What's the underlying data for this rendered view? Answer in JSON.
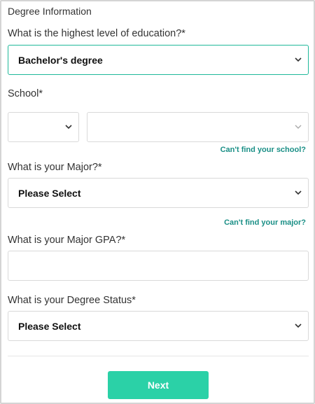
{
  "form": {
    "section_title": "Degree Information",
    "education": {
      "label": "What is the highest level of education?*",
      "value": "Bachelor's degree"
    },
    "school": {
      "label": "School*",
      "state_value": "",
      "school_value": "",
      "help_link": "Can't find your school?"
    },
    "major": {
      "label": "What is your Major?*",
      "value": "Please Select",
      "help_link": "Can't find your major?"
    },
    "gpa": {
      "label": "What is your Major GPA?*",
      "value": ""
    },
    "degree_status": {
      "label": "What is your Degree Status*",
      "value": "Please Select"
    },
    "next_label": "Next"
  },
  "colors": {
    "accent": "#2bd1a7",
    "link": "#1a8f86",
    "active_border": "#1fb89a",
    "border": "#d9d9d9"
  }
}
